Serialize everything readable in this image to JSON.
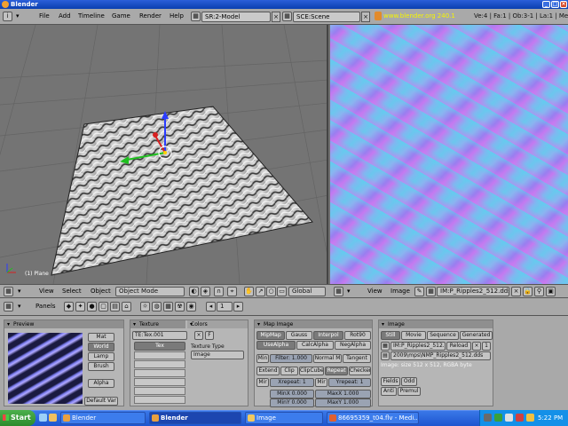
{
  "window": {
    "title": "Blender"
  },
  "infobar": {
    "menus": [
      "File",
      "Add",
      "Timeline",
      "Game",
      "Render",
      "Help"
    ],
    "screen": "SR:2-Model",
    "scene": "SCE:Scene",
    "website": "www.blender.org 240.1",
    "stats": "Ve:4 | Fa:1 | Ob:3-1 | La:1 | Mem"
  },
  "viewport": {
    "label": "(1) Plane"
  },
  "viewheader_left": {
    "menus": [
      "View",
      "Select",
      "Object"
    ],
    "mode": "Object Mode",
    "orientation": "Global"
  },
  "viewheader_right": {
    "menus": [
      "View",
      "Image"
    ],
    "image_name": "IM:P_Ripples2_512.dds"
  },
  "buttons_header": {
    "panels_label": "Panels",
    "frame": "1"
  },
  "preview_panel": {
    "title": "Preview",
    "buttons": [
      "Mat",
      "World",
      "Lamp",
      "Brush",
      "Alpha",
      "Default Var"
    ]
  },
  "texture_panel": {
    "tab1": "Texture",
    "tab2": "Colors",
    "name": "TE:Tex.001",
    "channel": "Tex",
    "users": "F",
    "type_label": "Texture Type",
    "type_value": "Image"
  },
  "mapimage_panel": {
    "title": "Map Image",
    "row1": [
      "MipMap",
      "Gauss",
      "Interpol",
      "Rot90"
    ],
    "row2": [
      "UseAlpha",
      "CalcAlpha",
      "NegAlpha"
    ],
    "min_label": "Min",
    "filter": "Filter: 1.000",
    "normal_map": "Normal M",
    "tangent": "Tangent",
    "row4": [
      "Extend",
      "Clip",
      "ClipCube",
      "Repeat",
      "Checker"
    ],
    "mir": "Mir",
    "xrepeat": "Xrepeat: 1",
    "mir2": "Mir",
    "yrepeat": "Yrepeat: 1",
    "minx": "MinX 0.000",
    "maxx": "MaxX 1.000",
    "miny": "MinY 0.000",
    "maxy": "MaxY 1.000"
  },
  "image_panel": {
    "title": "Image",
    "tabs": [
      "Still",
      "Movie",
      "Sequence",
      "Generated"
    ],
    "name": "IM:P_Ripples2_512.dds",
    "reload": "Reload",
    "users": "1",
    "path": "2009\\mps\\NMP_Ripples2_512.dds",
    "info": "Image: size 512 x 512, RGBA byte",
    "fields": "Fields",
    "odd": "Odd",
    "anti": "Anti",
    "premul": "Premul"
  },
  "taskbar": {
    "start": "Start",
    "tasks": [
      "Blender",
      "Blender",
      "Image",
      "86695359_t04.flv - Medi..."
    ],
    "clock": "5:22 PM"
  },
  "colors": {
    "title_blue": "#0a3fb0",
    "website_yellow": "#f6f600",
    "taskbar_blue": "#1d55cf",
    "start_green": "#2c8a2c"
  }
}
